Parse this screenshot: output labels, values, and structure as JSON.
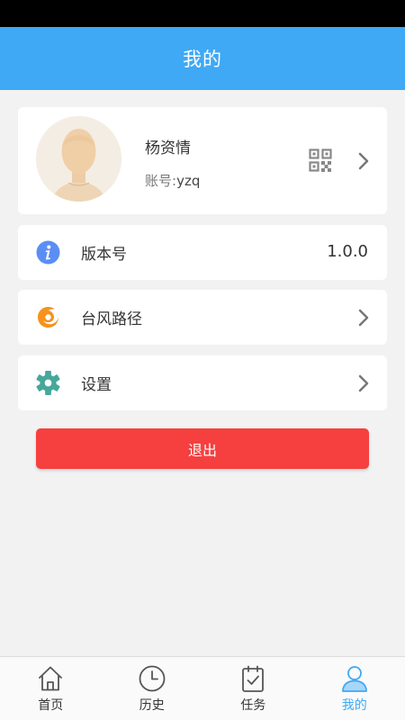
{
  "header": {
    "title": "我的"
  },
  "profile": {
    "name": "杨资情",
    "account_label": "账号:",
    "account_value": "yzq",
    "avatar_icon": "user-avatar-silhouette",
    "qr_icon": "qr-code-icon"
  },
  "rows": {
    "version": {
      "label": "版本号",
      "value": "1.0.0",
      "icon": "info-icon"
    },
    "typhoon": {
      "label": "台风路径",
      "icon": "typhoon-icon"
    },
    "settings": {
      "label": "设置",
      "icon": "gear-icon"
    }
  },
  "logout": {
    "label": "退出"
  },
  "tabs": [
    {
      "label": "首页",
      "icon": "home-icon"
    },
    {
      "label": "历史",
      "icon": "clock-icon"
    },
    {
      "label": "任务",
      "icon": "clipboard-check-icon"
    },
    {
      "label": "我的",
      "icon": "person-icon",
      "active": true
    }
  ],
  "colors": {
    "accent": "#3fa9f5",
    "logout": "#f5403f",
    "info_icon": "#5b8ef5",
    "typhoon_icon": "#f6921e",
    "gear_icon": "#46a79a"
  }
}
